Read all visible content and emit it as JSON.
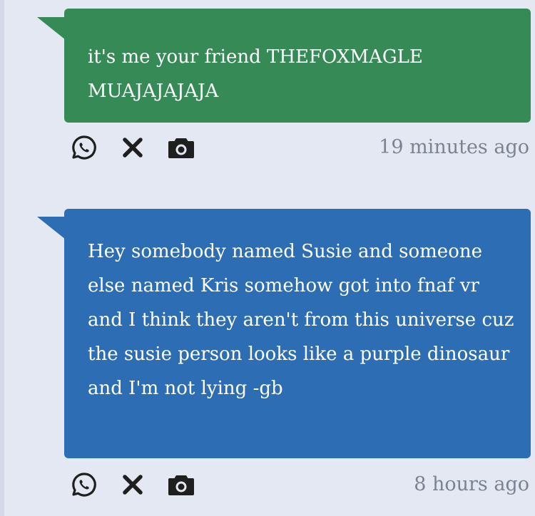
{
  "messages": [
    {
      "text": "it's me your friend THEFOXMAGLE MUAJAJAJAJA",
      "timestamp": "19 minutes ago",
      "bubble_color": "#358a56"
    },
    {
      "text": "Hey somebody named Susie and someone else named Kris somehow got into fnaf vr and I think they aren't from this universe cuz the susie person looks like a purple dinosaur and I'm not lying -gb",
      "timestamp": "8 hours ago",
      "bubble_color": "#2d6db4"
    }
  ],
  "actions": {
    "whatsapp": "whatsapp-icon",
    "x": "x-icon",
    "camera": "camera-icon"
  },
  "colors": {
    "background": "#e4e8f2",
    "icon": "#1f1f1f",
    "timestamp": "#7b8393"
  }
}
